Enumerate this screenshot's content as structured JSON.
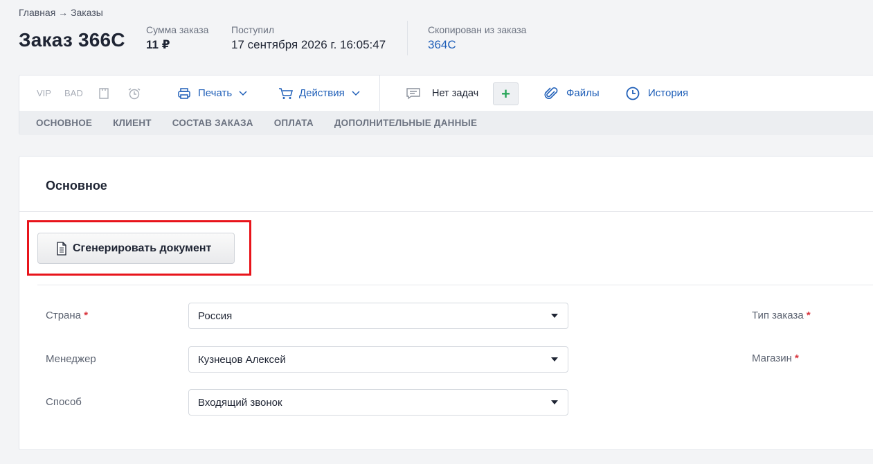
{
  "breadcrumb": "Главная → Заказы",
  "order": {
    "title": "Заказ 366С",
    "sum_label": "Сумма заказа",
    "sum_value": "11 ₽",
    "received_label": "Поступил",
    "received_value": "17 сентября 2026 г. 16:05:47",
    "copied_label": "Скопирован из заказа",
    "copied_value": "364С"
  },
  "toolbar": {
    "vip": "VIP",
    "bad": "BAD",
    "print": "Печать",
    "actions": "Действия",
    "tasks": "Нет задач",
    "files": "Файлы",
    "history": "История"
  },
  "tabs": [
    "ОСНОВНОЕ",
    "КЛИЕНТ",
    "СОСТАВ ЗАКАЗА",
    "ОПЛАТА",
    "ДОПОЛНИТЕЛЬНЫЕ ДАННЫЕ"
  ],
  "section": {
    "title": "Основное",
    "generate_button": "Сгенерировать документ"
  },
  "fields": {
    "country_label": "Страна",
    "country_value": "Россия",
    "manager_label": "Менеджер",
    "manager_value": "Кузнецов Алексей",
    "method_label": "Способ",
    "method_value": "Входящий звонок",
    "order_type_label": "Тип заказа",
    "store_label": "Магазин",
    "required_mark": "*"
  },
  "colors": {
    "accent": "#1f5fb8",
    "highlight": "#e8141b",
    "required": "#d9363e",
    "plus": "#2aa65a"
  }
}
